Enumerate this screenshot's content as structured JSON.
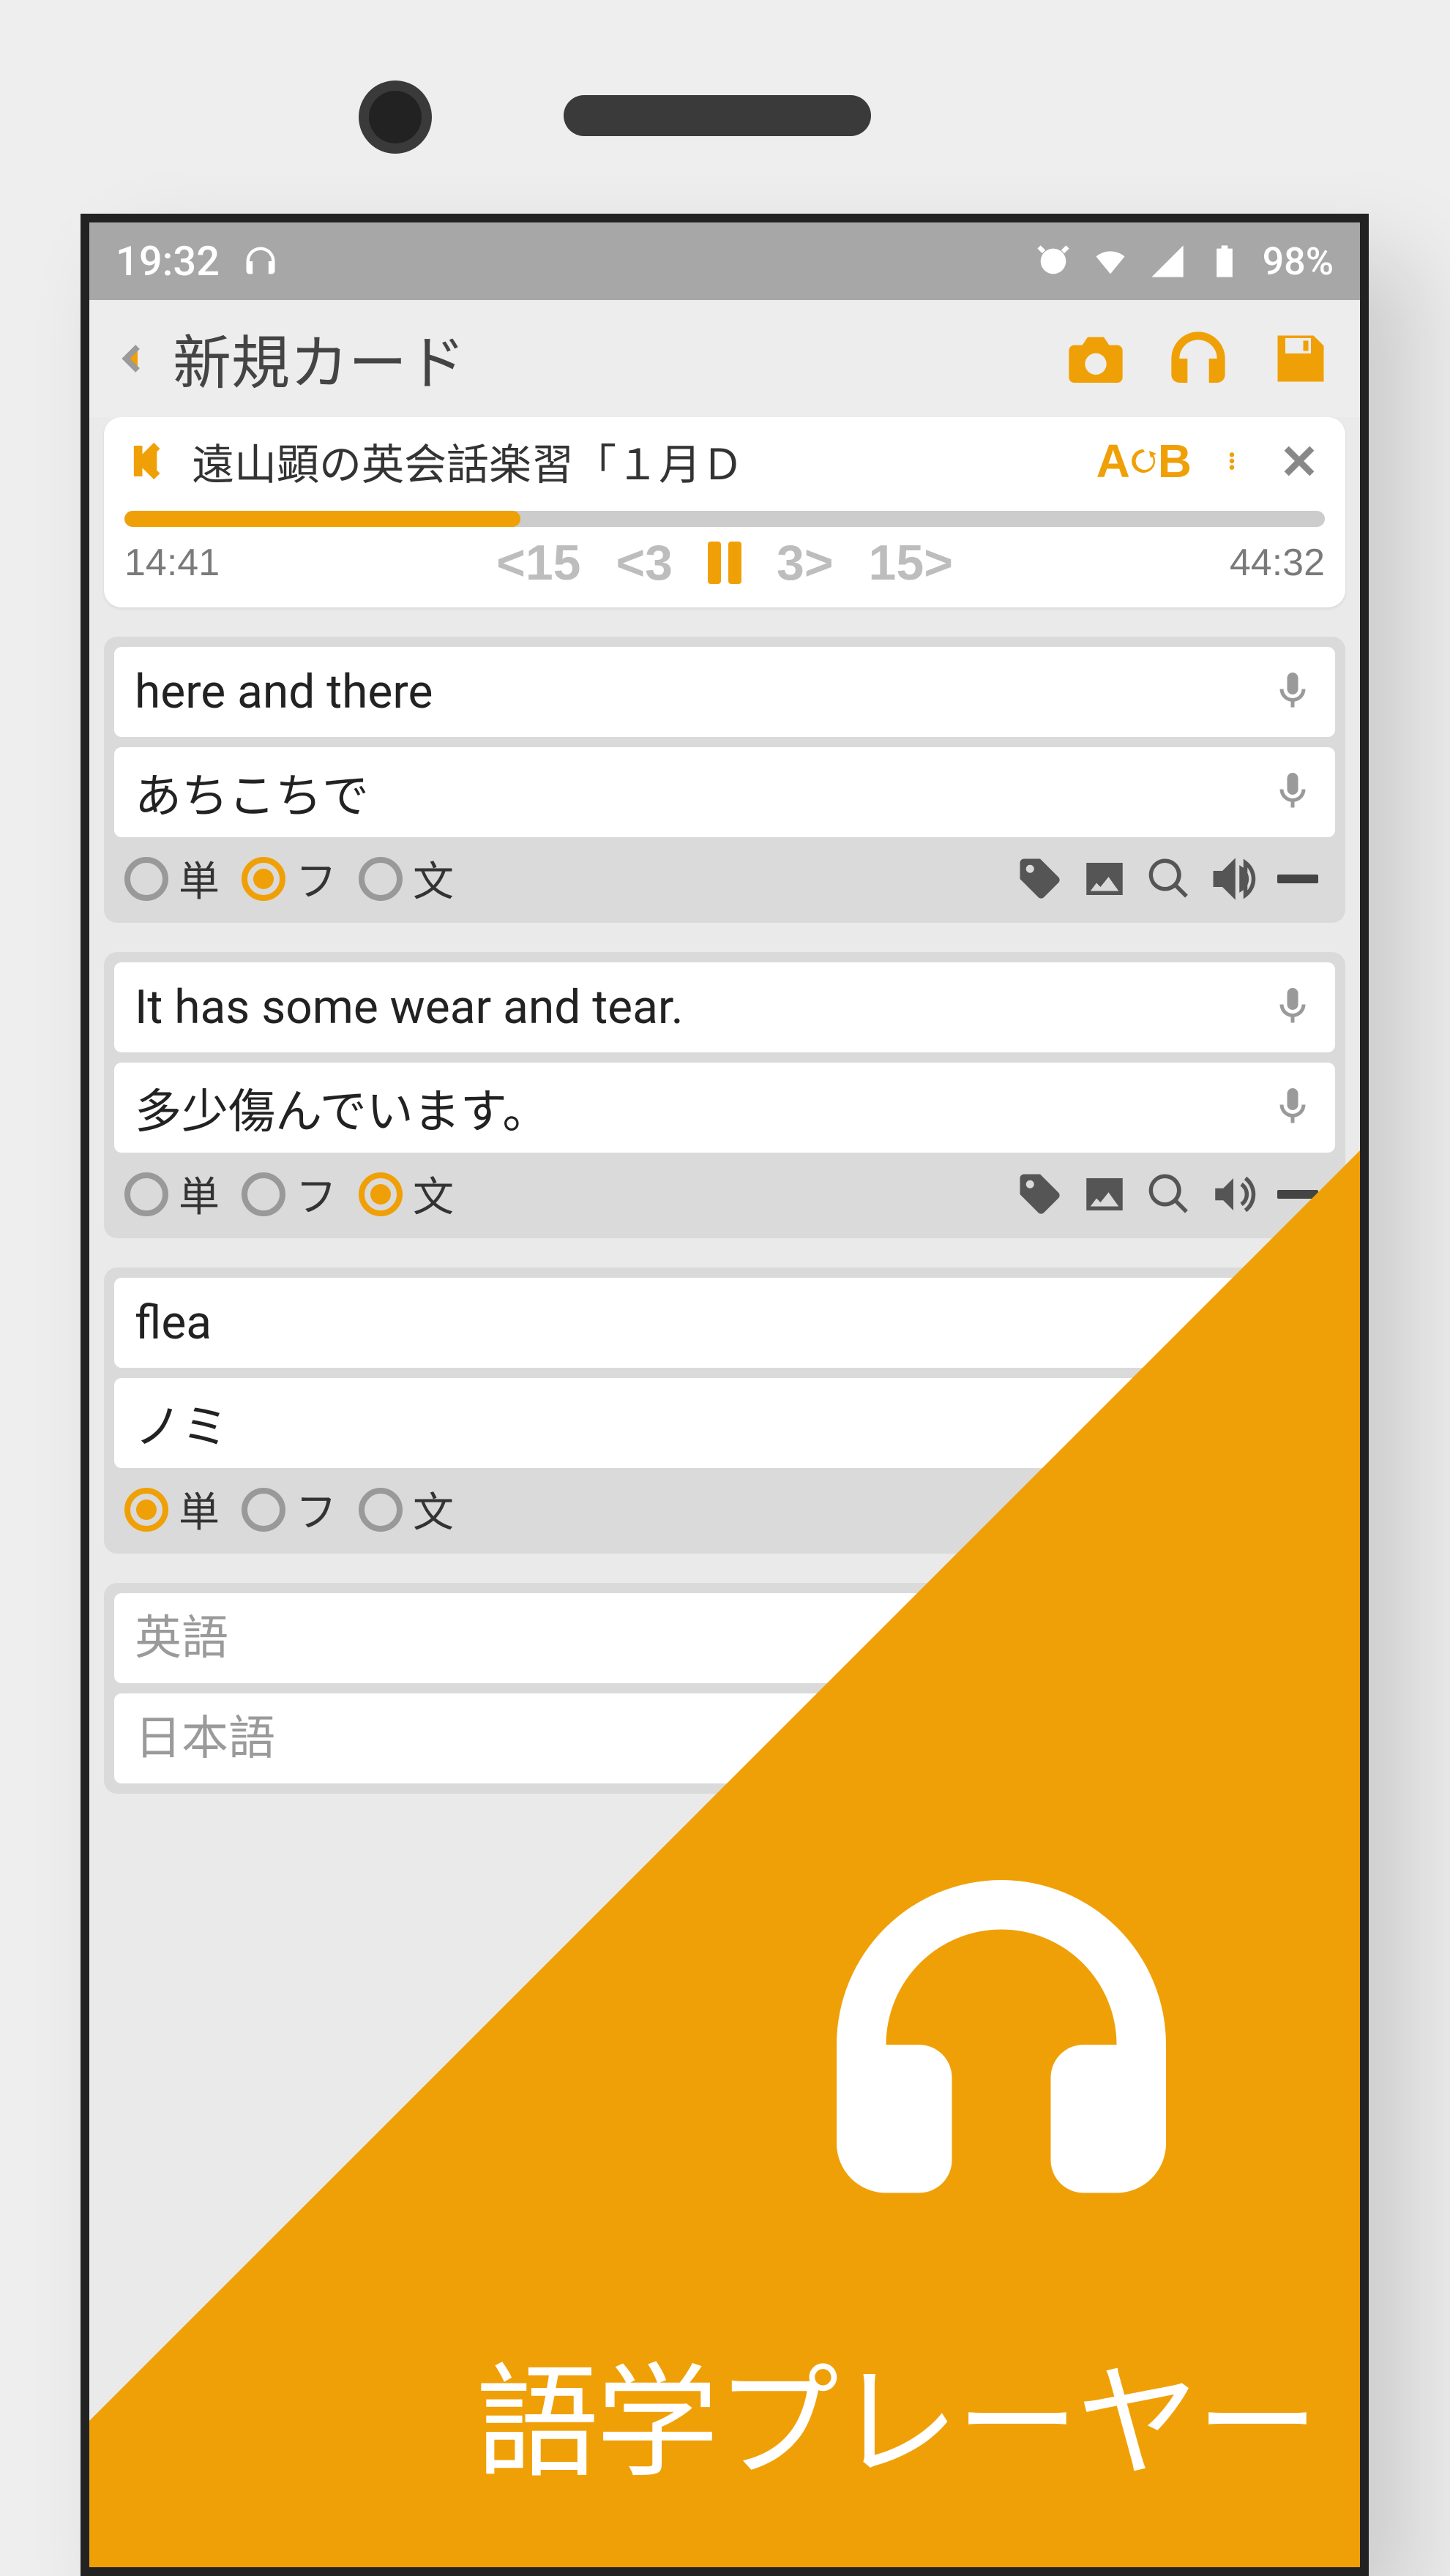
{
  "statusbar": {
    "time": "19:32",
    "battery": "98%"
  },
  "appbar": {
    "title": "新規カード"
  },
  "player": {
    "track_title": "遠山顕の英会話楽習「１月Ｄ",
    "ab_label": "A↻B",
    "progress_percent": 33,
    "time_elapsed": "14:41",
    "time_total": "44:32",
    "skip_back_big": "15",
    "skip_back_small": "3",
    "skip_fwd_small": "3",
    "skip_fwd_big": "15"
  },
  "radios": {
    "tan": "単",
    "fu": "フ",
    "bun": "文"
  },
  "cards": [
    {
      "front": "here and there",
      "back": "あちこちで",
      "selected": "fu"
    },
    {
      "front": "It has some wear and tear.",
      "back": "多少傷んでいます。",
      "selected": "bun"
    },
    {
      "front": "flea",
      "back": "ノミ",
      "selected": "tan"
    }
  ],
  "empty": {
    "front_placeholder": "英語",
    "back_placeholder": "日本語"
  },
  "promo": {
    "caption": "語学プレーヤー"
  }
}
